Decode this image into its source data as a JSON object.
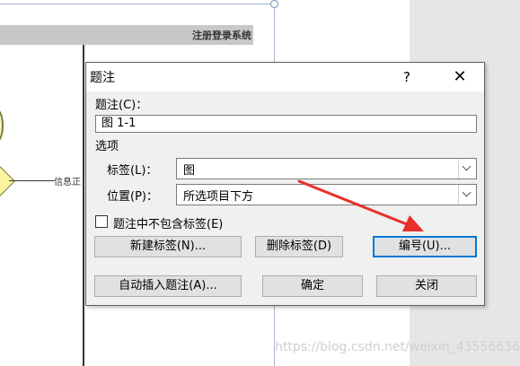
{
  "background": {
    "header_title": "注册登录系统",
    "node_label": "信息正"
  },
  "dialog": {
    "title": "题注",
    "help_label": "?",
    "close_label": "✕",
    "caption_label": "题注(C)：",
    "caption_value": "图 1-1",
    "options_label": "选项",
    "label_label": "标签(L)：",
    "label_value": "图",
    "position_label": "位置(P)：",
    "position_value": "所选项目下方",
    "exclude_label": "题注中不包含标签(E)",
    "buttons": {
      "new_label": "新建标签(N)...",
      "delete_label": "删除标签(D)",
      "numbering": "编号(U)...",
      "auto_caption": "自动插入题注(A)...",
      "ok": "确定",
      "cancel": "关闭"
    }
  },
  "annotation": {
    "arrow_color": "#e8302a"
  },
  "watermark": "https://blog.csdn.net/weixin_43556636"
}
